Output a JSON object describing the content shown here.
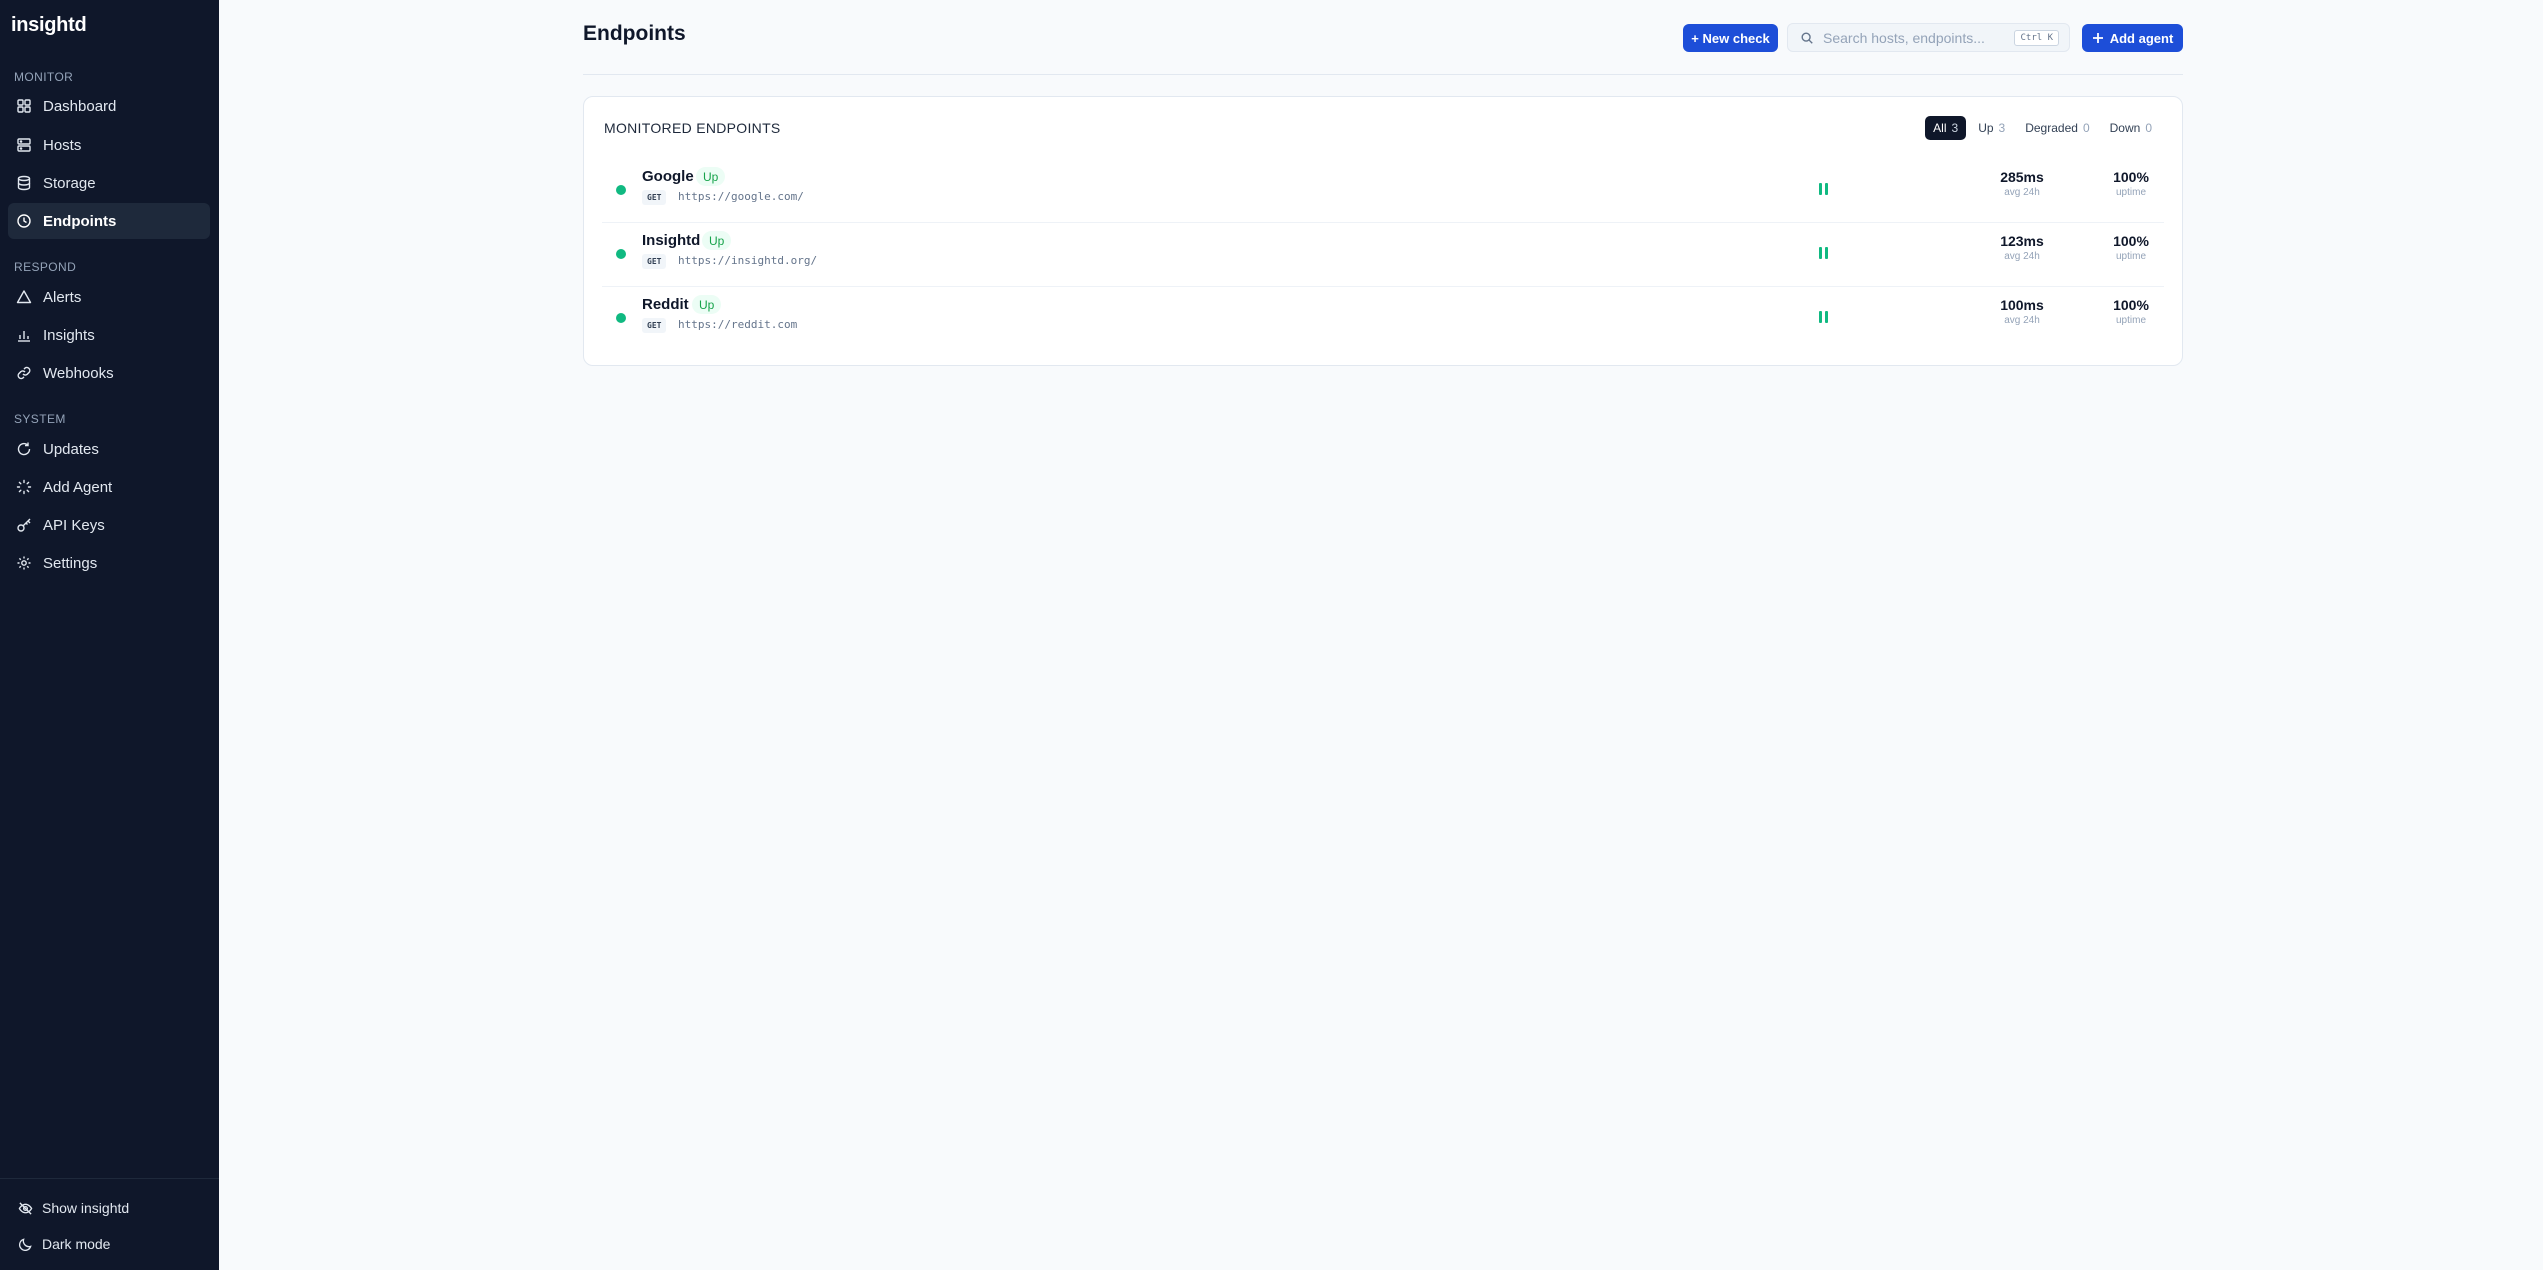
{
  "app": {
    "logo": "insightd"
  },
  "sidebar": {
    "sections": [
      {
        "label": "MONITOR"
      },
      {
        "label": "RESPOND"
      },
      {
        "label": "SYSTEM"
      }
    ],
    "items": [
      {
        "label": "Dashboard",
        "icon": "grid-icon"
      },
      {
        "label": "Hosts",
        "icon": "server-icon"
      },
      {
        "label": "Storage",
        "icon": "database-icon"
      },
      {
        "label": "Endpoints",
        "icon": "clock-icon",
        "active": true
      },
      {
        "label": "Alerts",
        "icon": "warning-icon"
      },
      {
        "label": "Insights",
        "icon": "chart-icon"
      },
      {
        "label": "Webhooks",
        "icon": "link-icon"
      },
      {
        "label": "Updates",
        "icon": "refresh-icon"
      },
      {
        "label": "Add Agent",
        "icon": "loader-icon"
      },
      {
        "label": "API Keys",
        "icon": "key-icon"
      },
      {
        "label": "Settings",
        "icon": "gear-icon"
      }
    ],
    "bottom": [
      {
        "label": "Show insightd",
        "icon": "eye-off-icon"
      },
      {
        "label": "Dark mode",
        "icon": "moon-icon"
      }
    ]
  },
  "header": {
    "title": "Endpoints",
    "new_check_label": "+ New check",
    "search_placeholder": "Search hosts, endpoints...",
    "search_shortcut": "Ctrl K",
    "add_agent_label": "Add agent"
  },
  "card": {
    "title": "MONITORED ENDPOINTS",
    "filters": [
      {
        "label": "All",
        "count": "3",
        "active": true
      },
      {
        "label": "Up",
        "count": "3"
      },
      {
        "label": "Degraded",
        "count": "0"
      },
      {
        "label": "Down",
        "count": "0"
      }
    ],
    "endpoints": [
      {
        "name": "Google",
        "status": "Up",
        "method": "GET",
        "url": "https://google.com/",
        "latency": "285ms",
        "latency_label": "avg 24h",
        "uptime": "100%",
        "uptime_label": "uptime"
      },
      {
        "name": "Insightd",
        "status": "Up",
        "method": "GET",
        "url": "https://insightd.org/",
        "latency": "123ms",
        "latency_label": "avg 24h",
        "uptime": "100%",
        "uptime_label": "uptime"
      },
      {
        "name": "Reddit",
        "status": "Up",
        "method": "GET",
        "url": "https://reddit.com",
        "latency": "100ms",
        "latency_label": "avg 24h",
        "uptime": "100%",
        "uptime_label": "uptime"
      }
    ]
  },
  "colors": {
    "sidebar_bg": "#0f172a",
    "accent": "#1d4ed8",
    "status_up": "#10b981"
  }
}
